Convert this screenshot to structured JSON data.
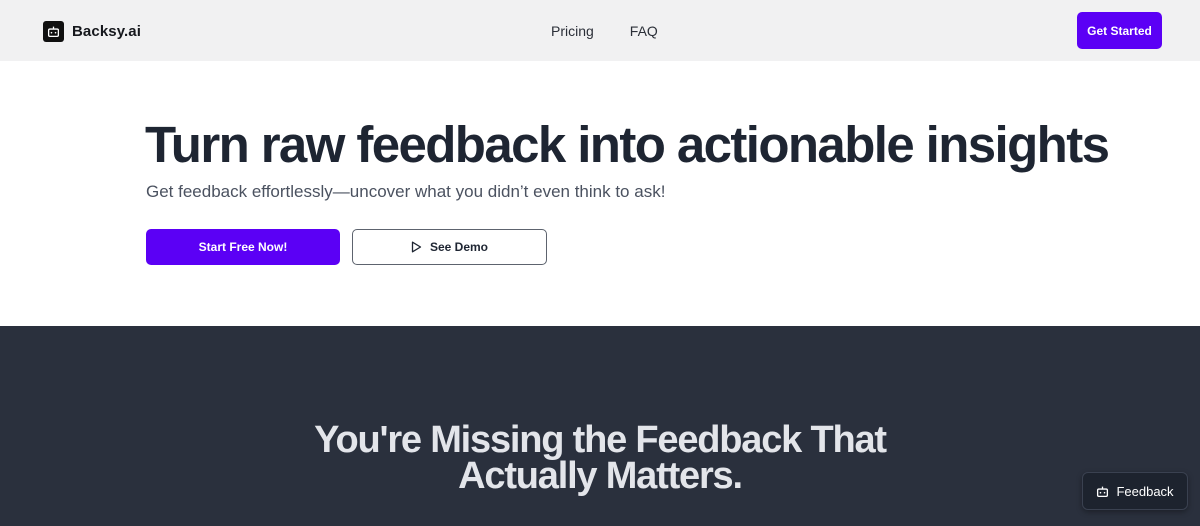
{
  "header": {
    "brand_name": "Backsy.ai",
    "brand_icon": "robot-face-icon",
    "nav": [
      {
        "label": "Pricing"
      },
      {
        "label": "FAQ"
      }
    ],
    "cta_label": "Get Started"
  },
  "hero": {
    "title": "Turn raw feedback into actionable insights",
    "subtitle": "Get feedback effortlessly—uncover what you didn’t even think to ask!",
    "primary_button": "Start Free Now!",
    "secondary_button": "See Demo",
    "secondary_icon": "play-icon"
  },
  "section": {
    "title_line1": "You're Missing the Feedback That",
    "title_line2": "Actually Matters."
  },
  "feedback_widget": {
    "label": "Feedback",
    "icon": "robot-face-icon"
  },
  "colors": {
    "accent": "#5b00f5",
    "header_bg": "#f1f1f2",
    "dark_section_bg": "#2a303d",
    "heading_text": "#1e2532"
  }
}
